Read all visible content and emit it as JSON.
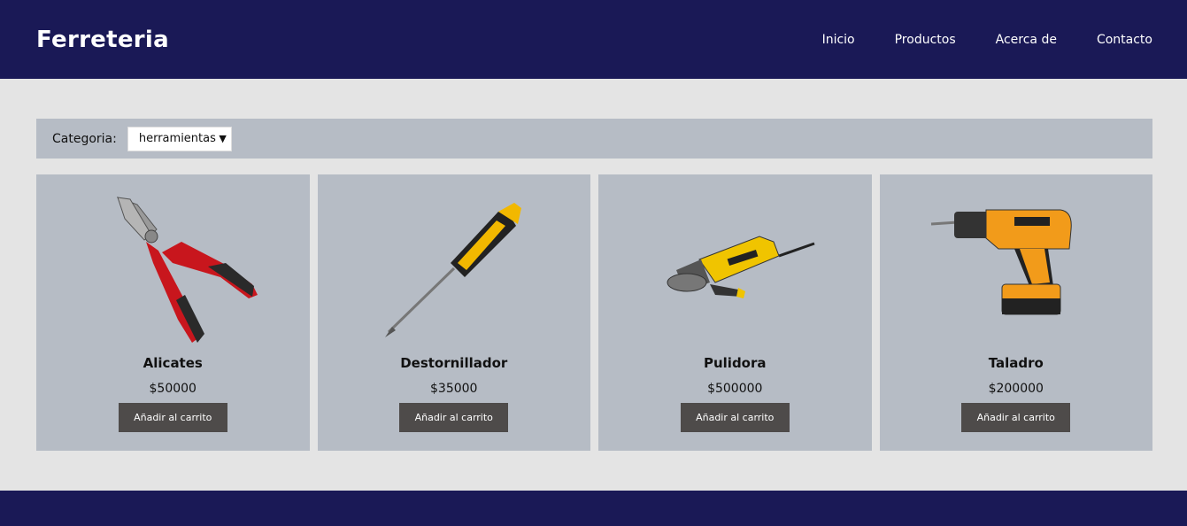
{
  "header": {
    "brand": "Ferreteria",
    "nav": [
      "Inicio",
      "Productos",
      "Acerca de",
      "Contacto"
    ]
  },
  "filter": {
    "label": "Categoria:",
    "selected": "herramientas"
  },
  "products": [
    {
      "name": "Alicates",
      "price": "$50000",
      "button": "Añadir al carrito",
      "icon": "pliers-icon"
    },
    {
      "name": "Destornillador",
      "price": "$35000",
      "button": "Añadir al carrito",
      "icon": "screwdriver-icon"
    },
    {
      "name": "Pulidora",
      "price": "$500000",
      "button": "Añadir al carrito",
      "icon": "angle-grinder-icon"
    },
    {
      "name": "Taladro",
      "price": "$200000",
      "button": "Añadir al carrito",
      "icon": "drill-icon"
    }
  ],
  "colors": {
    "header_bg": "#1a1956",
    "page_bg": "#e4e4e4",
    "card_bg": "#b6bcc5",
    "button_bg": "#4e4b4a"
  }
}
